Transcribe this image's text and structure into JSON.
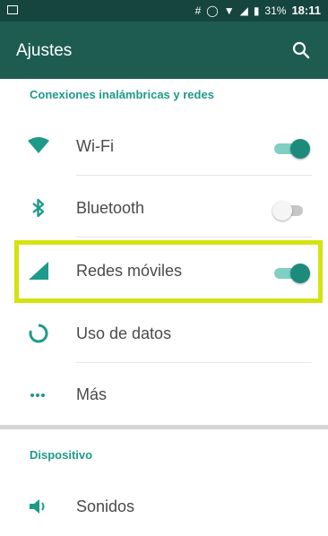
{
  "status_bar": {
    "battery_percent": "31%",
    "time": "18:11"
  },
  "app_bar": {
    "title": "Ajustes",
    "search_icon": "search-icon"
  },
  "sections": [
    {
      "title": "Conexiones inalámbricas y redes"
    },
    {
      "title": "Dispositivo"
    }
  ],
  "items": [
    {
      "label": "Wi-Fi",
      "icon": "wifi-icon",
      "toggle": "on"
    },
    {
      "label": "Bluetooth",
      "icon": "bluetooth-icon",
      "toggle": "off"
    },
    {
      "label": "Redes móviles",
      "icon": "mobile-signal-icon",
      "toggle": "on"
    },
    {
      "label": "Uso de datos",
      "icon": "data-usage-icon"
    },
    {
      "label": "Más",
      "icon": "more-icon"
    },
    {
      "label": "Sonidos",
      "icon": "volume-icon"
    }
  ],
  "colors": {
    "accent": "#1d9a8a",
    "app_bar": "#1e5c52",
    "highlight": "#d4e30e"
  }
}
